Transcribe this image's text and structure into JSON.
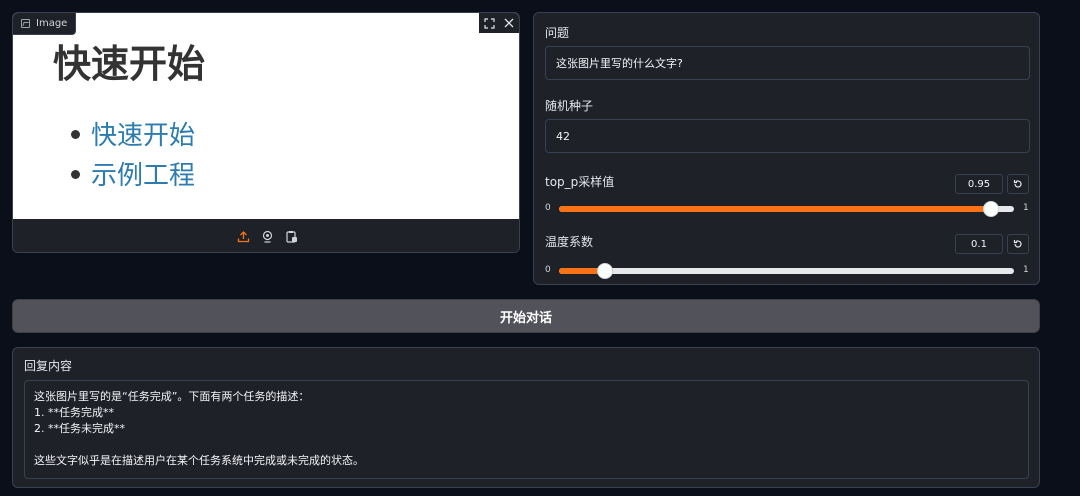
{
  "image_panel": {
    "label": "Image",
    "preview": {
      "title": "快速开始",
      "list": [
        "快速开始",
        "示例工程"
      ]
    },
    "tools": [
      "fullscreen-icon",
      "close-icon"
    ],
    "footer_icons": [
      "upload-icon",
      "webcam-icon",
      "clipboard-icon"
    ]
  },
  "question": {
    "label": "问题",
    "value": "这张图片里写的什么文字?"
  },
  "seed": {
    "label": "随机种子",
    "value": "42"
  },
  "top_p": {
    "label": "top_p采样值",
    "value": "0.95",
    "min": "0",
    "max": "1",
    "fraction": 0.95
  },
  "temperature": {
    "label": "温度系数",
    "value": "0.1",
    "min": "0",
    "max": "1",
    "fraction": 0.1
  },
  "start_button": {
    "label": "开始对话"
  },
  "response": {
    "label": "回复内容",
    "text": "这张图片里写的是“任务完成”。下面有两个任务的描述：\n1. **任务完成**\n2. **任务未完成**\n\n这些文字似乎是在描述用户在某个任务系统中完成或未完成的状态。"
  },
  "colors": {
    "accent": "#f97316",
    "background": "#0b0f19",
    "panel": "#1f2128",
    "link": "#2d7cb0"
  }
}
